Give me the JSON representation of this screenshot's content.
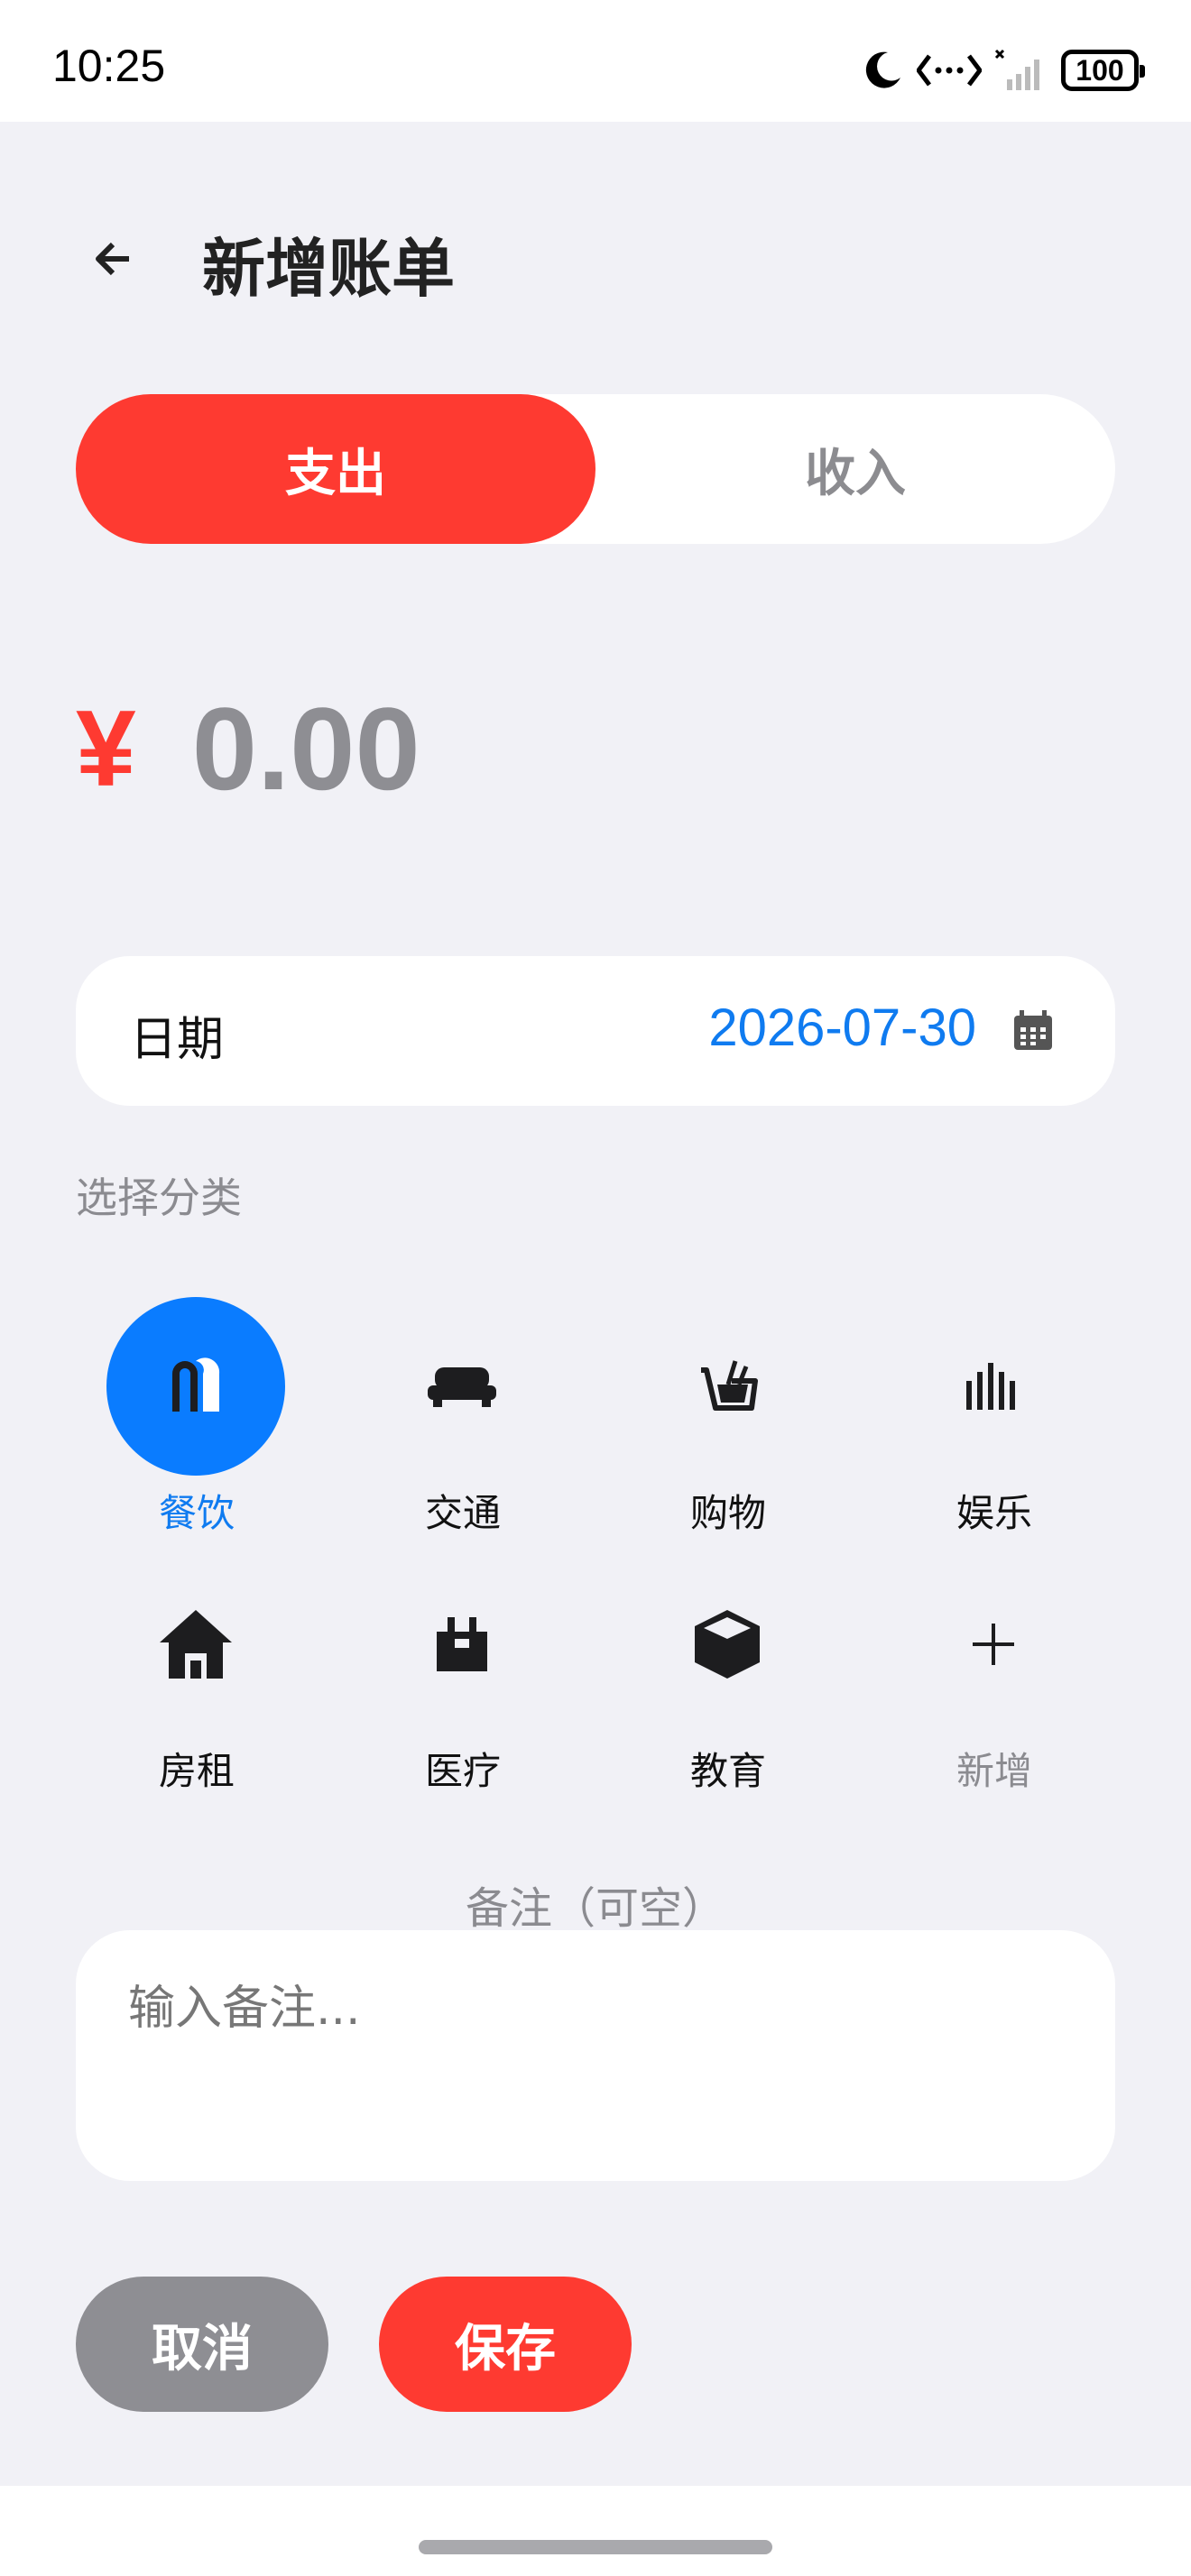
{
  "status_bar": {
    "time": "10:25",
    "battery": "100"
  },
  "header": {
    "title": "新增账单"
  },
  "type_toggle": {
    "expense": "支出",
    "income": "收入",
    "active": "expense",
    "active_color": "#fe3a31"
  },
  "amount": {
    "currency": "¥",
    "value": "0.00"
  },
  "date": {
    "label": "日期",
    "value": "2026-07-30"
  },
  "category_section": {
    "label": "选择分类"
  },
  "categories": [
    {
      "label": "餐饮",
      "icon": "restaurant-icon",
      "selected": true
    },
    {
      "label": "交通",
      "icon": "car-icon",
      "selected": false
    },
    {
      "label": "购物",
      "icon": "shopping-basket-icon",
      "selected": false
    },
    {
      "label": "娱乐",
      "icon": "equalizer-icon",
      "selected": false
    },
    {
      "label": "房租",
      "icon": "house-icon",
      "selected": false
    },
    {
      "label": "医疗",
      "icon": "medical-icon",
      "selected": false
    },
    {
      "label": "教育",
      "icon": "cube-icon",
      "selected": false
    },
    {
      "label": "新增",
      "icon": "plus-icon",
      "selected": false
    }
  ],
  "note": {
    "label": "备注（可空）",
    "placeholder": "输入备注..."
  },
  "actions": {
    "cancel": "取消",
    "save": "保存"
  },
  "colors": {
    "accent_red": "#fe3a31",
    "accent_blue": "#0a7cff",
    "muted": "#8e8e93"
  }
}
